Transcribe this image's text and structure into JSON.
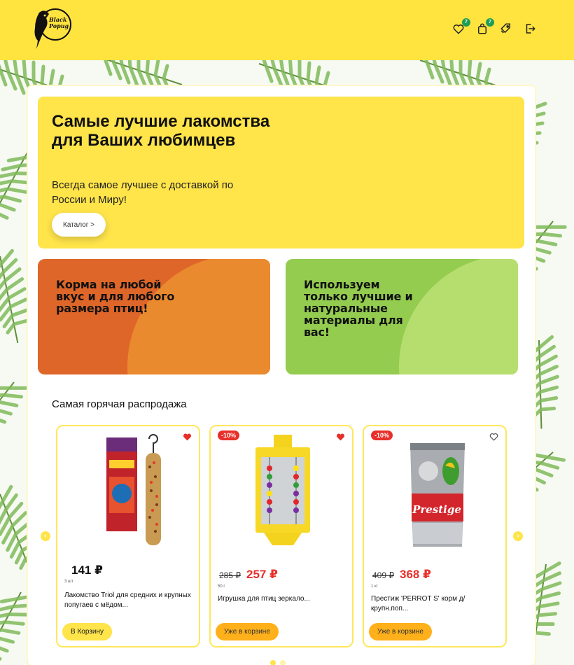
{
  "header": {
    "logo_text": "Black Popug",
    "favorites_count": "7",
    "cart_count": "7"
  },
  "hero": {
    "title": "Самые лучшие лакомства для Ваших любимцев",
    "subtitle": "Всегда самое лучшее с доставкой по России и Миру!",
    "button_label": "Каталог >"
  },
  "promos": [
    {
      "text": "Корма на любой вкус и для любого размера птиц!",
      "color": "#df6629"
    },
    {
      "text": "Используем только лучшие и натуральные материалы для вас!",
      "color": "#93cc4f"
    }
  ],
  "sale": {
    "title": "Самая горячая распродажа",
    "products": [
      {
        "discount": "",
        "favorite": true,
        "old_price": "",
        "price": "141 ₽",
        "qty": "3 шт",
        "name": "Лакомство Triol для средних и крупных попугаев с мёдом...",
        "button": "В Корзину"
      },
      {
        "discount": "-10%",
        "favorite": true,
        "old_price": "285 ₽",
        "price": "257 ₽",
        "qty": "50 г",
        "name": "Игрушка для птиц зеркало...",
        "button": "Уже в корзине"
      },
      {
        "discount": "-10%",
        "favorite": false,
        "old_price": "409 ₽",
        "price": "368 ₽",
        "qty": "1 кг",
        "name": "Престиж 'PERROT S' корм д/крупн.поп...",
        "button": "Уже в корзине"
      }
    ]
  },
  "colors": {
    "accent": "#ffe44a",
    "sale": "#e8302a",
    "in_cart": "#ffb01a"
  }
}
